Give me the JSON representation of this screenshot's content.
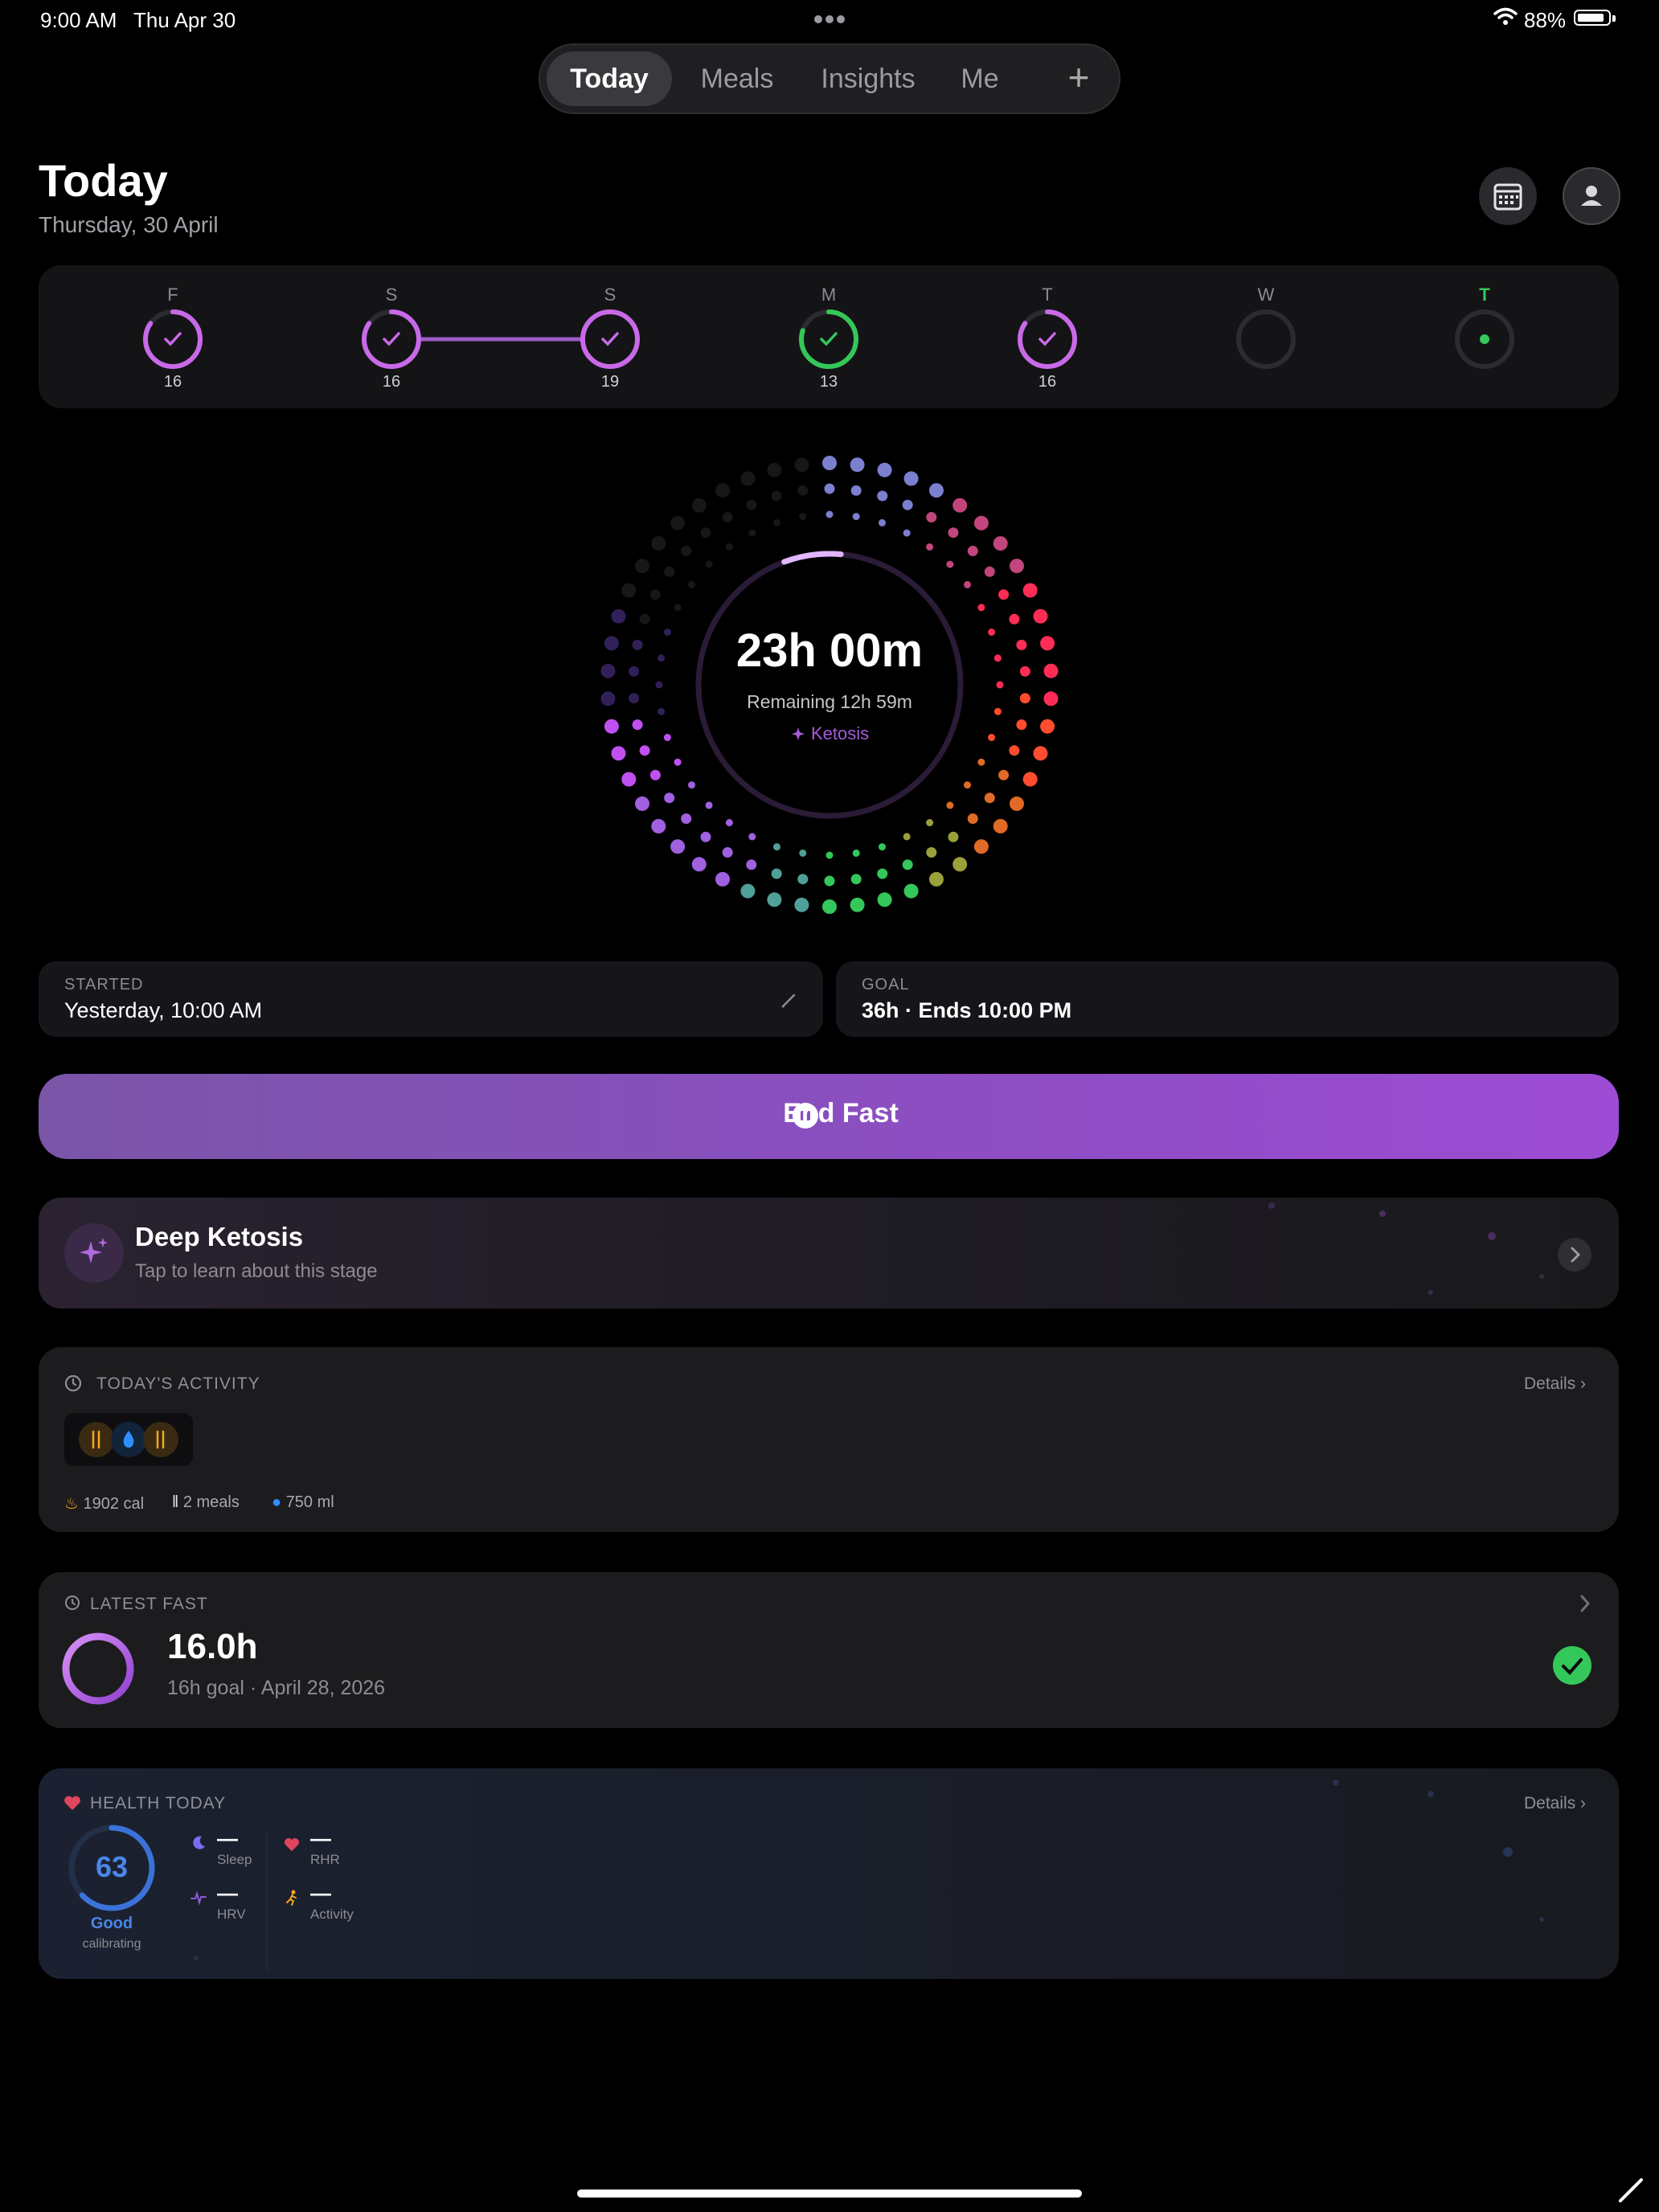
{
  "status": {
    "time": "9:00 AM",
    "date": "Thu Apr 30",
    "battery": "88%"
  },
  "tabs": [
    {
      "label": "Today",
      "active": true
    },
    {
      "label": "Meals"
    },
    {
      "label": "Insights"
    },
    {
      "label": "Me"
    }
  ],
  "tab_add": "+",
  "header": {
    "title": "Today",
    "subtitle": "Thursday, 30 April"
  },
  "week": [
    {
      "letter": "F",
      "hours": "16",
      "state": "done",
      "color": "#c86ae8",
      "progress": 0.85
    },
    {
      "letter": "S",
      "hours": "16",
      "state": "done",
      "color": "#c86ae8",
      "progress": 0.85
    },
    {
      "letter": "S",
      "hours": "19",
      "state": "done",
      "color": "#c86ae8",
      "progress": 1.0
    },
    {
      "letter": "M",
      "hours": "13",
      "state": "done",
      "color": "#34c759",
      "progress": 0.8
    },
    {
      "letter": "T",
      "hours": "16",
      "state": "done",
      "color": "#c86ae8",
      "progress": 0.85
    },
    {
      "letter": "W",
      "hours": "",
      "state": "empty",
      "color": "#3a3a3e",
      "progress": 0
    },
    {
      "letter": "T",
      "hours": "",
      "state": "today",
      "color": "#34c759",
      "progress": 0
    }
  ],
  "timer": {
    "elapsed": "23h 00m",
    "remaining": "Remaining 12h 59m",
    "stage": "Ketosis",
    "progress": 0.64
  },
  "started": {
    "label": "STARTED",
    "value": "Yesterday, 10:00 AM"
  },
  "goal": {
    "label": "GOAL",
    "value": "36h · Ends 10:00 PM"
  },
  "end_button": "End Fast",
  "stage_card": {
    "title": "Deep Ketosis",
    "subtitle": "Tap to learn about this stage"
  },
  "activity": {
    "title": "TODAY'S ACTIVITY",
    "details": "Details",
    "calories": "1902 cal",
    "meals": "2 meals",
    "water": "750 ml"
  },
  "latest_fast": {
    "title": "LATEST FAST",
    "hours": "16.0h",
    "goal": "16h goal",
    "date": "April 28, 2026"
  },
  "health": {
    "title": "HEALTH TODAY",
    "details": "Details",
    "score": "63",
    "rating": "Good",
    "note": "calibrating",
    "sleep_value": "—",
    "sleep_label": "Sleep",
    "rhr_value": "—",
    "rhr_label": "RHR",
    "hrv_value": "—",
    "hrv_label": "HRV",
    "activity_value": "—",
    "activity_label": "Activity"
  },
  "colors": {
    "accent": "#a855f7",
    "green": "#34c759",
    "background": "#000000"
  }
}
